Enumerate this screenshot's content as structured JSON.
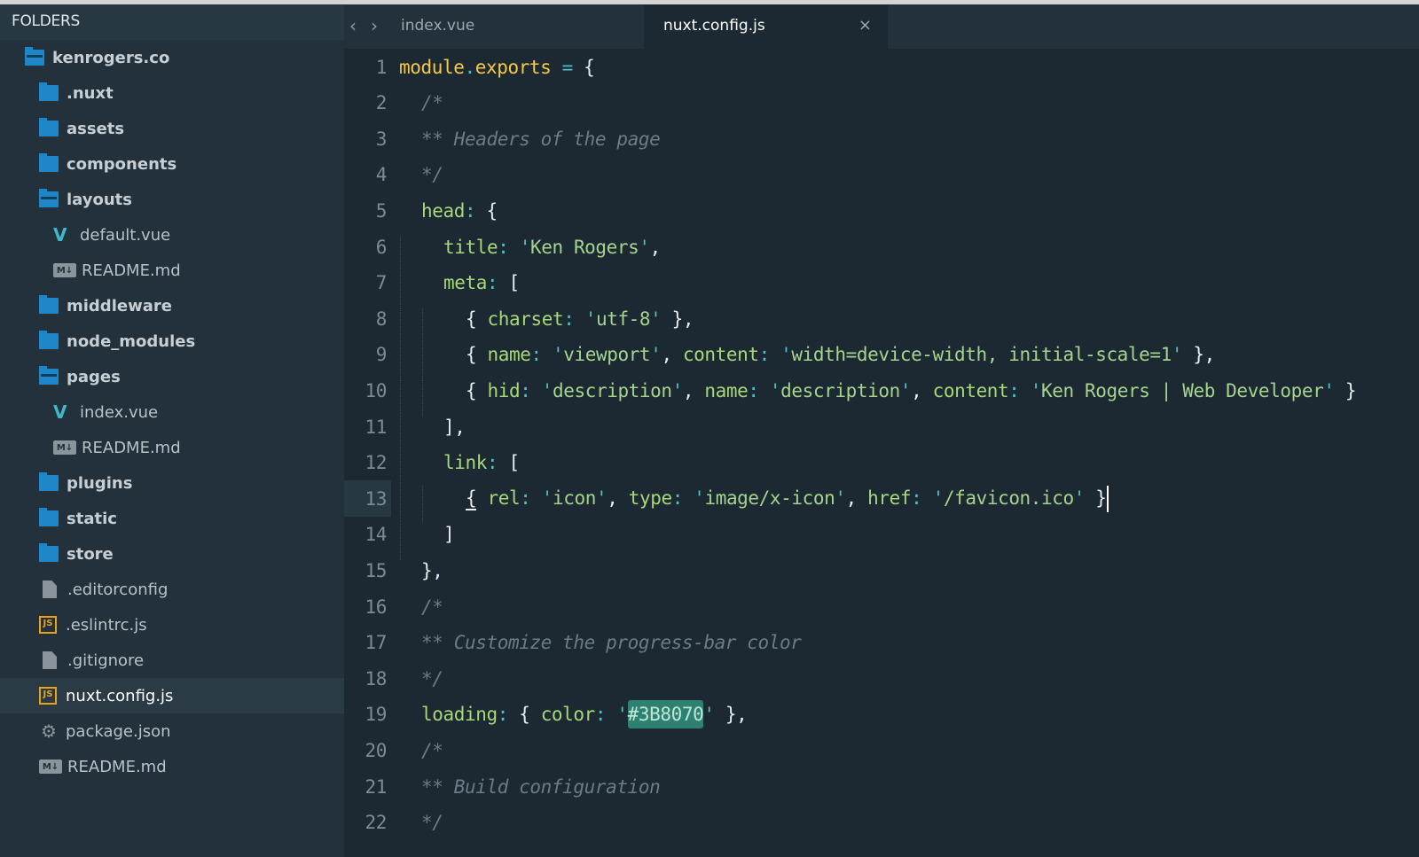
{
  "sidebar": {
    "header": "FOLDERS",
    "items": [
      {
        "label": "kenrogers.co",
        "icon": "folder-open-icon",
        "level": 0,
        "kind": "folder-open"
      },
      {
        "label": ".nuxt",
        "icon": "folder-icon",
        "level": 1,
        "kind": "folder"
      },
      {
        "label": "assets",
        "icon": "folder-icon",
        "level": 1,
        "kind": "folder"
      },
      {
        "label": "components",
        "icon": "folder-icon",
        "level": 1,
        "kind": "folder"
      },
      {
        "label": "layouts",
        "icon": "folder-open-icon",
        "level": 1,
        "kind": "folder-open"
      },
      {
        "label": "default.vue",
        "icon": "vue-file-icon",
        "level": 2,
        "kind": "vue"
      },
      {
        "label": "README.md",
        "icon": "markdown-file-icon",
        "level": 2,
        "kind": "md"
      },
      {
        "label": "middleware",
        "icon": "folder-icon",
        "level": 1,
        "kind": "folder"
      },
      {
        "label": "node_modules",
        "icon": "folder-icon",
        "level": 1,
        "kind": "folder"
      },
      {
        "label": "pages",
        "icon": "folder-open-icon",
        "level": 1,
        "kind": "folder-open"
      },
      {
        "label": "index.vue",
        "icon": "vue-file-icon",
        "level": 2,
        "kind": "vue"
      },
      {
        "label": "README.md",
        "icon": "markdown-file-icon",
        "level": 2,
        "kind": "md"
      },
      {
        "label": "plugins",
        "icon": "folder-icon",
        "level": 1,
        "kind": "folder"
      },
      {
        "label": "static",
        "icon": "folder-icon",
        "level": 1,
        "kind": "folder"
      },
      {
        "label": "store",
        "icon": "folder-icon",
        "level": 1,
        "kind": "folder"
      },
      {
        "label": ".editorconfig",
        "icon": "file-icon",
        "level": 1,
        "kind": "doc"
      },
      {
        "label": ".eslintrc.js",
        "icon": "js-file-icon",
        "level": 1,
        "kind": "js"
      },
      {
        "label": ".gitignore",
        "icon": "file-icon",
        "level": 1,
        "kind": "doc"
      },
      {
        "label": "nuxt.config.js",
        "icon": "js-file-icon",
        "level": 1,
        "kind": "js",
        "active": true
      },
      {
        "label": "package.json",
        "icon": "gear-icon",
        "level": 1,
        "kind": "gear"
      },
      {
        "label": "README.md",
        "icon": "markdown-file-icon",
        "level": 1,
        "kind": "md"
      }
    ]
  },
  "tabs": [
    {
      "label": "index.vue",
      "active": false
    },
    {
      "label": "nuxt.config.js",
      "active": true,
      "close": "×"
    }
  ],
  "nav": {
    "back": "‹",
    "forward": "›"
  },
  "icon_glyphs": {
    "md": "M↓",
    "js": "JS",
    "vue": "V",
    "gear": "⚙"
  },
  "editor": {
    "active_line": 13,
    "lines": [
      {
        "n": "1",
        "indent": 0,
        "tokens": [
          [
            "kw",
            "module"
          ],
          [
            "op",
            "."
          ],
          [
            "kw",
            "exports"
          ],
          [
            "p",
            " "
          ],
          [
            "op",
            "="
          ],
          [
            "p",
            " {"
          ]
        ]
      },
      {
        "n": "2",
        "indent": 1,
        "tokens": [
          [
            "cm",
            "/*"
          ]
        ]
      },
      {
        "n": "3",
        "indent": 1,
        "tokens": [
          [
            "cm",
            "** Headers of the page"
          ]
        ]
      },
      {
        "n": "4",
        "indent": 1,
        "tokens": [
          [
            "cm",
            "*/"
          ]
        ]
      },
      {
        "n": "5",
        "indent": 1,
        "tokens": [
          [
            "prop",
            "head"
          ],
          [
            "op",
            ":"
          ],
          [
            "p",
            " {"
          ]
        ]
      },
      {
        "n": "6",
        "indent": 2,
        "tokens": [
          [
            "prop",
            "title"
          ],
          [
            "op",
            ":"
          ],
          [
            "p",
            " "
          ],
          [
            "op",
            "'"
          ],
          [
            "str",
            "Ken Rogers"
          ],
          [
            "op",
            "'"
          ],
          [
            "p",
            ","
          ]
        ]
      },
      {
        "n": "7",
        "indent": 2,
        "tokens": [
          [
            "prop",
            "meta"
          ],
          [
            "op",
            ":"
          ],
          [
            "p",
            " ["
          ]
        ]
      },
      {
        "n": "8",
        "indent": 3,
        "tokens": [
          [
            "p",
            "{ "
          ],
          [
            "prop",
            "charset"
          ],
          [
            "op",
            ":"
          ],
          [
            "p",
            " "
          ],
          [
            "op",
            "'"
          ],
          [
            "str",
            "utf-8"
          ],
          [
            "op",
            "'"
          ],
          [
            "p",
            " },"
          ]
        ]
      },
      {
        "n": "9",
        "indent": 3,
        "tokens": [
          [
            "p",
            "{ "
          ],
          [
            "prop",
            "name"
          ],
          [
            "op",
            ":"
          ],
          [
            "p",
            " "
          ],
          [
            "op",
            "'"
          ],
          [
            "str",
            "viewport"
          ],
          [
            "op",
            "'"
          ],
          [
            "p",
            ", "
          ],
          [
            "prop",
            "content"
          ],
          [
            "op",
            ":"
          ],
          [
            "p",
            " "
          ],
          [
            "op",
            "'"
          ],
          [
            "str",
            "width=device-width, initial-scale=1"
          ],
          [
            "op",
            "'"
          ],
          [
            "p",
            " },"
          ]
        ]
      },
      {
        "n": "10",
        "indent": 3,
        "tokens": [
          [
            "p",
            "{ "
          ],
          [
            "prop",
            "hid"
          ],
          [
            "op",
            ":"
          ],
          [
            "p",
            " "
          ],
          [
            "op",
            "'"
          ],
          [
            "str",
            "description"
          ],
          [
            "op",
            "'"
          ],
          [
            "p",
            ", "
          ],
          [
            "prop",
            "name"
          ],
          [
            "op",
            ":"
          ],
          [
            "p",
            " "
          ],
          [
            "op",
            "'"
          ],
          [
            "str",
            "description"
          ],
          [
            "op",
            "'"
          ],
          [
            "p",
            ", "
          ],
          [
            "prop",
            "content"
          ],
          [
            "op",
            ":"
          ],
          [
            "p",
            " "
          ],
          [
            "op",
            "'"
          ],
          [
            "str",
            "Ken Rogers | Web Developer"
          ],
          [
            "op",
            "'"
          ],
          [
            "p",
            " }"
          ]
        ]
      },
      {
        "n": "11",
        "indent": 2,
        "tokens": [
          [
            "p",
            "],"
          ]
        ]
      },
      {
        "n": "12",
        "indent": 2,
        "tokens": [
          [
            "prop",
            "link"
          ],
          [
            "op",
            ":"
          ],
          [
            "p",
            " ["
          ]
        ]
      },
      {
        "n": "13",
        "indent": 3,
        "tokens": [
          [
            "caret",
            "{"
          ],
          [
            "p",
            " "
          ],
          [
            "prop",
            "rel"
          ],
          [
            "op",
            ":"
          ],
          [
            "p",
            " "
          ],
          [
            "op",
            "'"
          ],
          [
            "str",
            "icon"
          ],
          [
            "op",
            "'"
          ],
          [
            "p",
            ", "
          ],
          [
            "prop",
            "type"
          ],
          [
            "op",
            ":"
          ],
          [
            "p",
            " "
          ],
          [
            "op",
            "'"
          ],
          [
            "str",
            "image/x-icon"
          ],
          [
            "op",
            "'"
          ],
          [
            "p",
            ", "
          ],
          [
            "prop",
            "href"
          ],
          [
            "op",
            ":"
          ],
          [
            "p",
            " "
          ],
          [
            "op",
            "'"
          ],
          [
            "str",
            "/favicon.ico"
          ],
          [
            "op",
            "'"
          ],
          [
            "p",
            " }"
          ]
        ]
      },
      {
        "n": "14",
        "indent": 2,
        "tokens": [
          [
            "p",
            "]"
          ]
        ]
      },
      {
        "n": "15",
        "indent": 1,
        "tokens": [
          [
            "p",
            "},"
          ]
        ]
      },
      {
        "n": "16",
        "indent": 1,
        "tokens": [
          [
            "cm",
            "/*"
          ]
        ]
      },
      {
        "n": "17",
        "indent": 1,
        "tokens": [
          [
            "cm",
            "** Customize the progress-bar color"
          ]
        ]
      },
      {
        "n": "18",
        "indent": 1,
        "tokens": [
          [
            "cm",
            "*/"
          ]
        ]
      },
      {
        "n": "19",
        "indent": 1,
        "tokens": [
          [
            "prop",
            "loading"
          ],
          [
            "op",
            ":"
          ],
          [
            "p",
            " { "
          ],
          [
            "prop",
            "color"
          ],
          [
            "op",
            ":"
          ],
          [
            "p",
            " "
          ],
          [
            "op",
            "'"
          ],
          [
            "hl",
            "#3B8070"
          ],
          [
            "op",
            "'"
          ],
          [
            "p",
            " },"
          ]
        ]
      },
      {
        "n": "20",
        "indent": 1,
        "tokens": [
          [
            "cm",
            "/*"
          ]
        ]
      },
      {
        "n": "21",
        "indent": 1,
        "tokens": [
          [
            "cm",
            "** Build configuration"
          ]
        ]
      },
      {
        "n": "22",
        "indent": 1,
        "tokens": [
          [
            "cm",
            "*/"
          ]
        ]
      }
    ]
  }
}
